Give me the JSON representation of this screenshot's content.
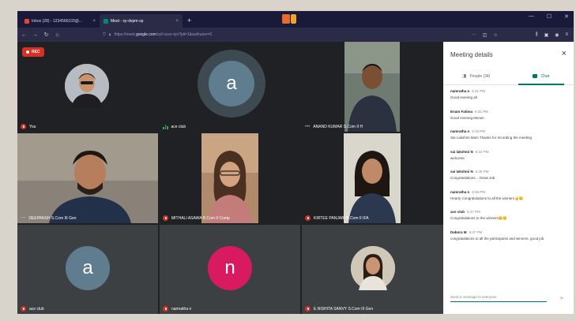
{
  "browser": {
    "tabs": [
      {
        "label": "Inbox (28) - 1234566103@..."
      },
      {
        "label": "Meet - sy-dvpm-vp"
      }
    ],
    "new_tab": "+",
    "url_host": "https://meet.",
    "url_domain": "google.com",
    "url_path": "/syf-ozzo-tyn?pli=1&authuser=0"
  },
  "meeting": {
    "rec_label": "REC",
    "tiles": [
      {
        "name": "You",
        "kind": "video"
      },
      {
        "name": "ace club",
        "kind": "avatar",
        "letter": "a"
      },
      {
        "name": "ANAND KUMAR S.Com II H",
        "kind": "video"
      },
      {
        "name": "DEEPANSH S.Com III Gen",
        "kind": "video"
      },
      {
        "name": "MITHALI ASAWA B.Com II Comp",
        "kind": "video"
      },
      {
        "name": "KIRTEE PANJABI B.Com II IFA",
        "kind": "video"
      },
      {
        "name": "ace club",
        "kind": "avatar",
        "letter": "a"
      },
      {
        "name": "namratha n",
        "kind": "avatar",
        "letter": "n"
      },
      {
        "name": "E.NISHITA SANVY S.Com III Gen",
        "kind": "video"
      }
    ]
  },
  "panel": {
    "title": "Meeting details",
    "close": "×",
    "tabs": {
      "people": "People (34)",
      "chat": "Chat"
    },
    "messages": [
      {
        "sender": "namratha n",
        "time": "6:31 PM",
        "text": "Good evening all"
      },
      {
        "sender": "Enam Fatima",
        "time": "6:31 PM",
        "text": "Good evening Ma'am"
      },
      {
        "sender": "namratha n",
        "time": "6:33 PM",
        "text": "Sai Lakshmi Mam Thanks for recording the meeting"
      },
      {
        "sender": "sai lakshmi N",
        "time": "6:33 PM",
        "text": "welcome"
      },
      {
        "sender": "sai lakshmi N",
        "time": "6:35 PM",
        "text": "Congratulations... Great Job"
      },
      {
        "sender": "namratha n",
        "time": "6:35 PM",
        "text": "Hearty Congratulations to all the winners👍😊"
      },
      {
        "sender": "ace club",
        "time": "6:37 PM",
        "text": "Congratulations to the winners😊😊"
      },
      {
        "sender": "Dabora M",
        "time": "6:37 PM",
        "text": "congratulations to all the participants and winners. good job"
      }
    ],
    "compose_placeholder": "Send a message to everyone"
  },
  "colors": {
    "rec": "#d93025",
    "avatar_a": "#5f7d8f",
    "avatar_n": "#d81b60",
    "chat_accent": "#00796b"
  }
}
